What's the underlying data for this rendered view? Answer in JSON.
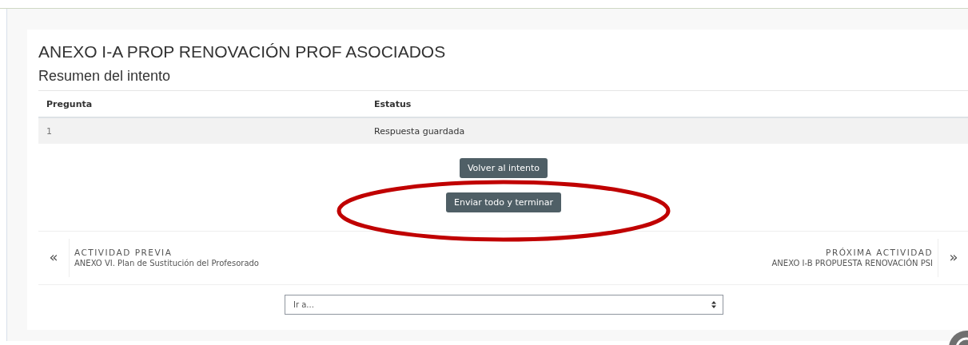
{
  "title": "ANEXO I-A PROP RENOVACIÓN PROF ASOCIADOS",
  "subtitle": "Resumen del intento",
  "table": {
    "columns": [
      "Pregunta",
      "Estatus"
    ],
    "rows": [
      [
        "1",
        "Respuesta guardada"
      ]
    ]
  },
  "buttons": [
    {
      "label": "Volver al intento",
      "highlighted": false
    },
    {
      "label": "Enviar todo y terminar",
      "highlighted": true
    }
  ],
  "navigation": {
    "previous": {
      "heading": "ACTIVIDAD PREVIA",
      "name": "ANEXO VI. Plan de Sustitución del Profesorado",
      "arrow": "«"
    },
    "next": {
      "heading": "PRÓXIMA ACTIVIDAD",
      "name": "ANEXO I-B PROPUESTA RENOVACIÓN PSI",
      "arrow": "»"
    }
  },
  "jump_select": {
    "placeholder": "Ir a..."
  }
}
